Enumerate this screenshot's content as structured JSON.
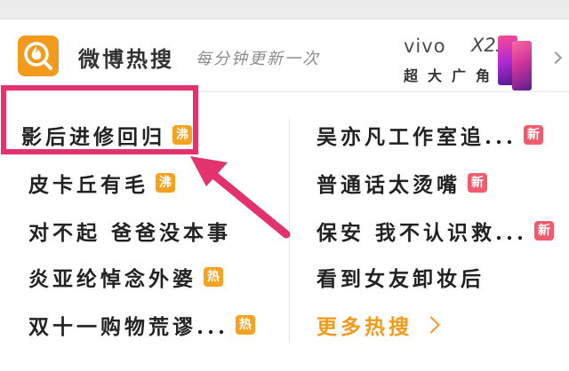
{
  "header": {
    "title": "微博热搜",
    "subtitle": "每分钟更新一次",
    "ad": {
      "brand": "vivo",
      "model": "X23",
      "slogan": "超大广角"
    }
  },
  "left_items": [
    {
      "text": "影后进修回归",
      "badge": "沸"
    },
    {
      "text": "皮卡丘有毛",
      "badge": "沸"
    },
    {
      "text": "对不起 爸爸没本事",
      "badge": ""
    },
    {
      "text": "炎亚纶悼念外婆",
      "badge": "热"
    },
    {
      "text": "双十一购物荒谬...",
      "badge": "热"
    }
  ],
  "right_items": [
    {
      "text": "吴亦凡工作室追...",
      "badge": "新"
    },
    {
      "text": "普通话太烫嘴",
      "badge": "新"
    },
    {
      "text": "保安 我不认识救...",
      "badge": "新"
    },
    {
      "text": "看到女友卸妆后",
      "badge": ""
    }
  ],
  "more_label": "更多热搜",
  "colors": {
    "accent": "#f29a1c",
    "new_badge": "#f25a6e",
    "hot_badge": "#f7a21e",
    "annotation": "#e2336e"
  },
  "icons": {
    "logo": "weibo-hot-search-flame-icon",
    "ad_arrow": "chevron-right-icon",
    "more_arrow": "chevron-right-icon"
  }
}
